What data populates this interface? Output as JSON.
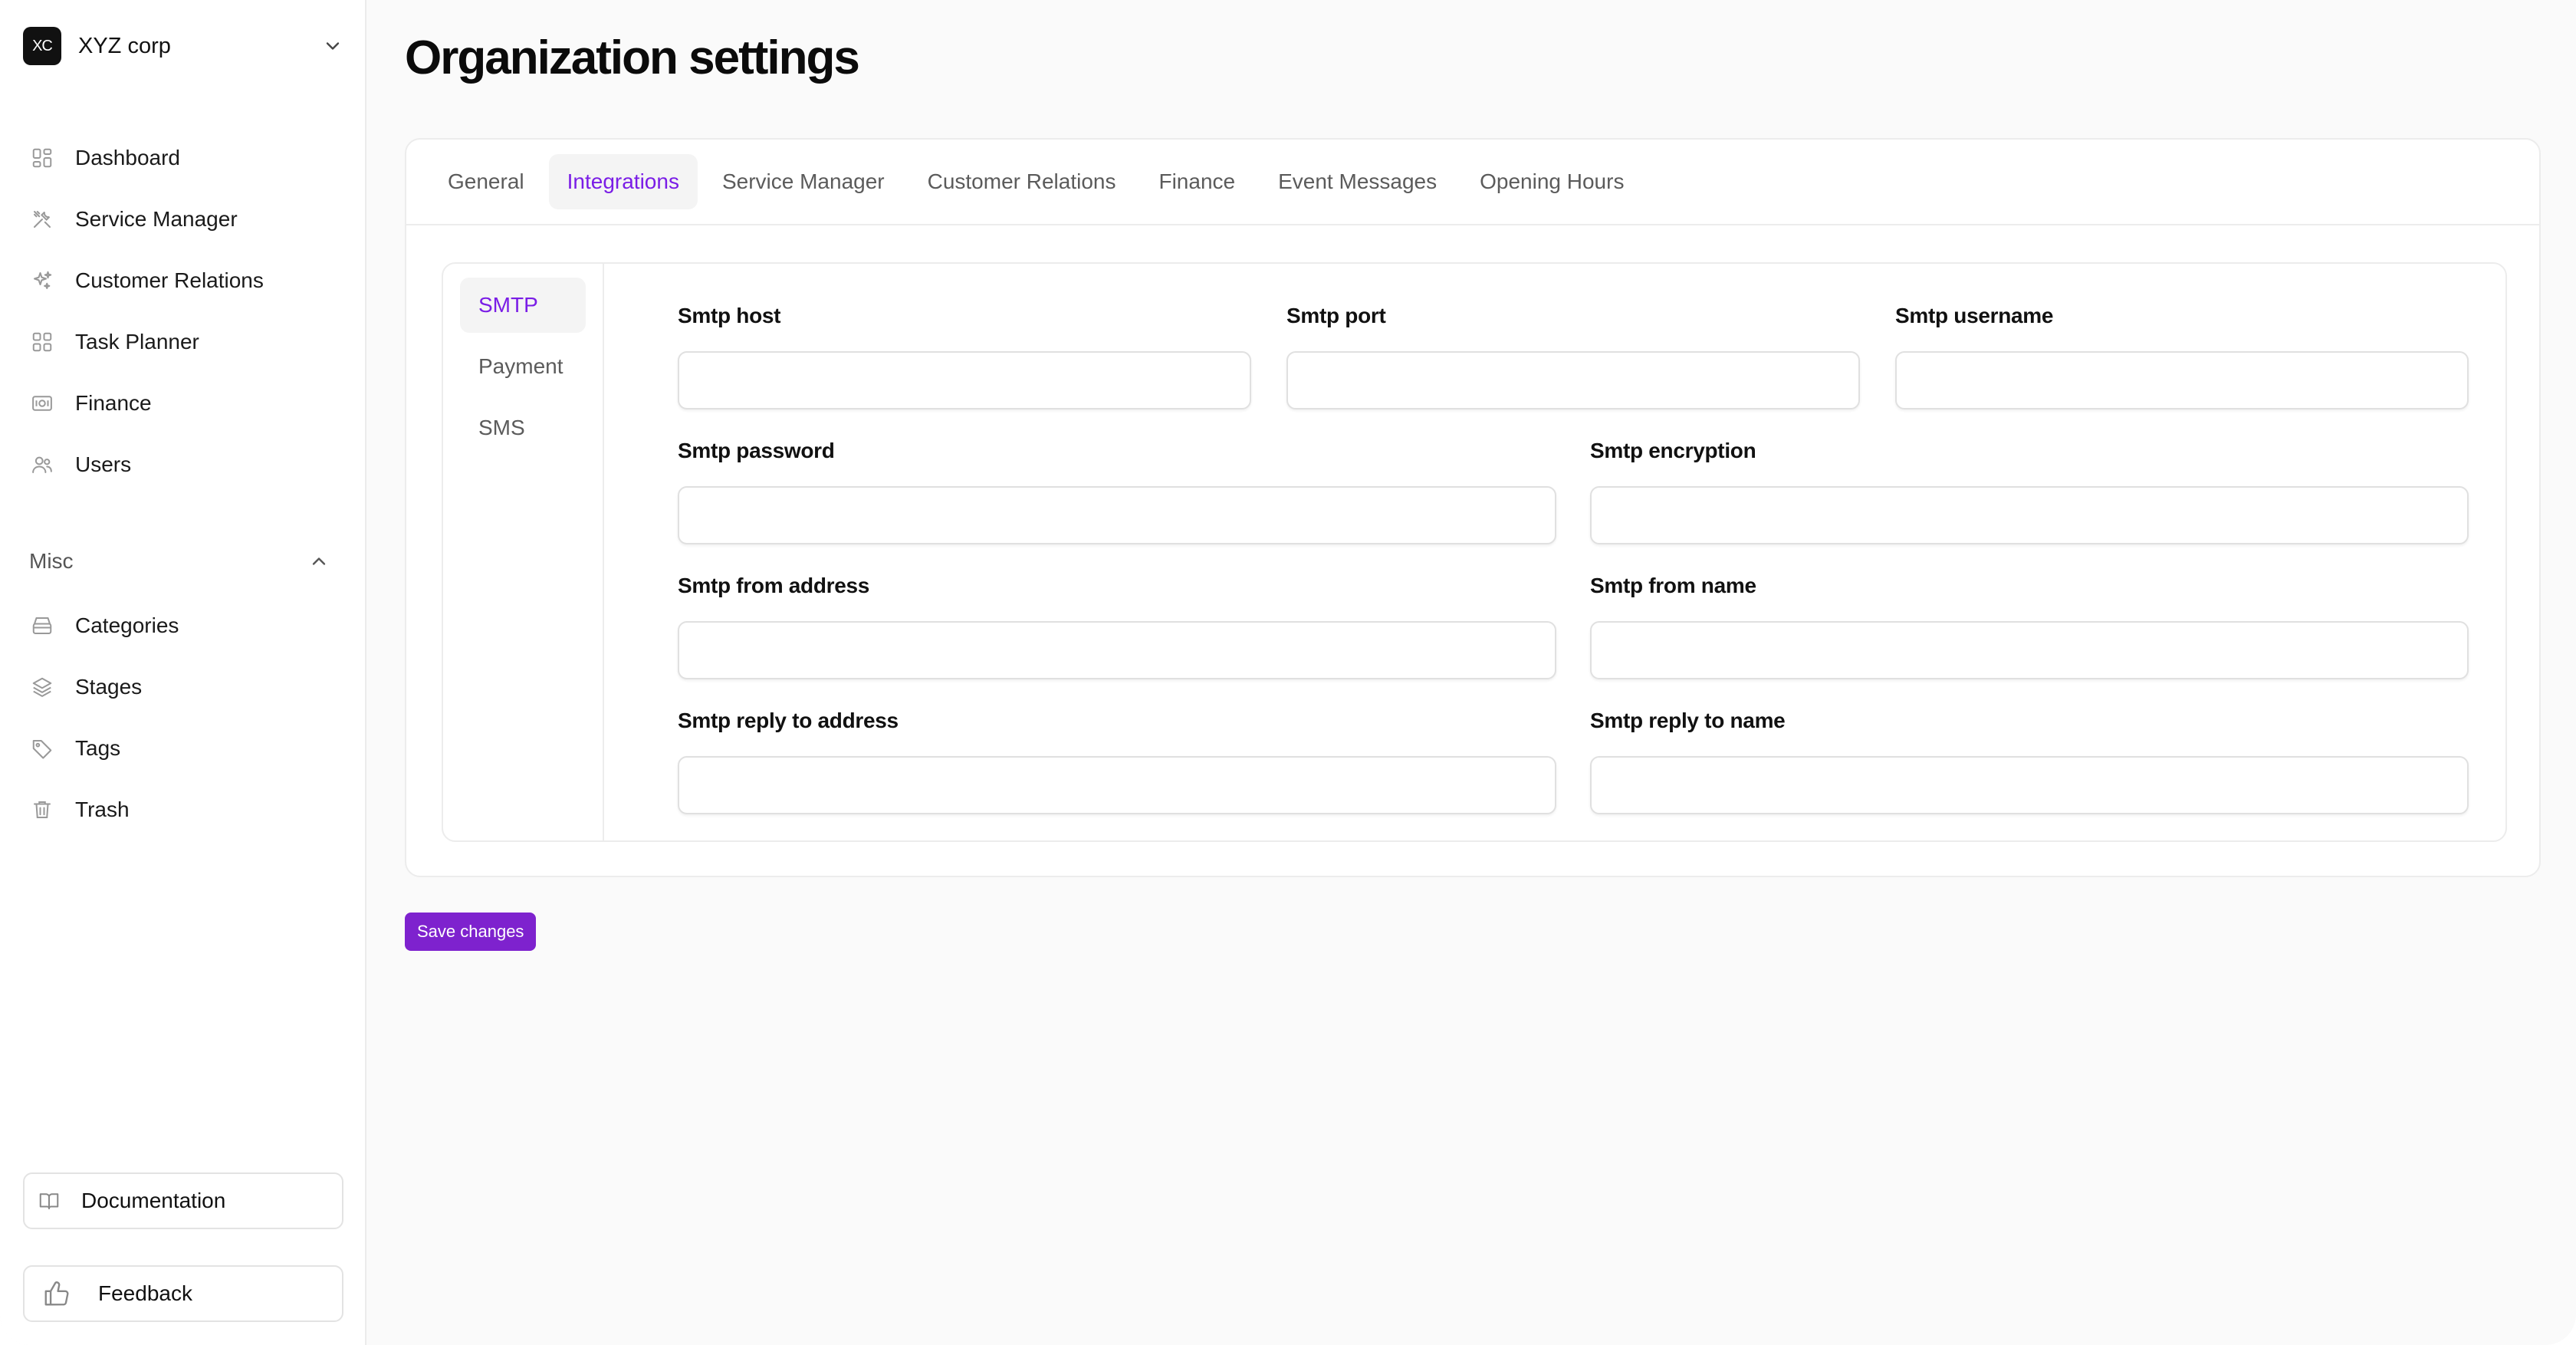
{
  "org": {
    "logo": "XC",
    "name": "XYZ corp"
  },
  "sidebar": {
    "items": [
      {
        "label": "Dashboard",
        "icon": "dashboard-icon"
      },
      {
        "label": "Service Manager",
        "icon": "tools-icon"
      },
      {
        "label": "Customer Relations",
        "icon": "sparkle-icon"
      },
      {
        "label": "Task Planner",
        "icon": "grid-icon"
      },
      {
        "label": "Finance",
        "icon": "banknote-icon"
      },
      {
        "label": "Users",
        "icon": "users-icon"
      }
    ],
    "misc_label": "Misc",
    "misc_items": [
      {
        "label": "Categories",
        "icon": "archive-icon"
      },
      {
        "label": "Stages",
        "icon": "layers-icon"
      },
      {
        "label": "Tags",
        "icon": "tag-icon"
      },
      {
        "label": "Trash",
        "icon": "trash-icon"
      }
    ],
    "documentation_label": "Documentation",
    "feedback_label": "Feedback"
  },
  "page": {
    "title": "Organization settings"
  },
  "tabs": [
    "General",
    "Integrations",
    "Service Manager",
    "Customer Relations",
    "Finance",
    "Event Messages",
    "Opening Hours"
  ],
  "active_tab": "Integrations",
  "subtabs": [
    "SMTP",
    "Payment",
    "SMS"
  ],
  "active_subtab": "SMTP",
  "form": {
    "smtp_host": {
      "label": "Smtp host",
      "value": ""
    },
    "smtp_port": {
      "label": "Smtp port",
      "value": ""
    },
    "smtp_username": {
      "label": "Smtp username",
      "value": ""
    },
    "smtp_password": {
      "label": "Smtp password",
      "value": ""
    },
    "smtp_encryption": {
      "label": "Smtp encryption",
      "value": ""
    },
    "smtp_from_address": {
      "label": "Smtp from address",
      "value": ""
    },
    "smtp_from_name": {
      "label": "Smtp from name",
      "value": ""
    },
    "smtp_reply_to_address": {
      "label": "Smtp reply to address",
      "value": ""
    },
    "smtp_reply_to_name": {
      "label": "Smtp reply to name",
      "value": ""
    }
  },
  "save_label": "Save changes",
  "colors": {
    "accent": "#7e22ce",
    "accent_text": "#7a1de6"
  }
}
